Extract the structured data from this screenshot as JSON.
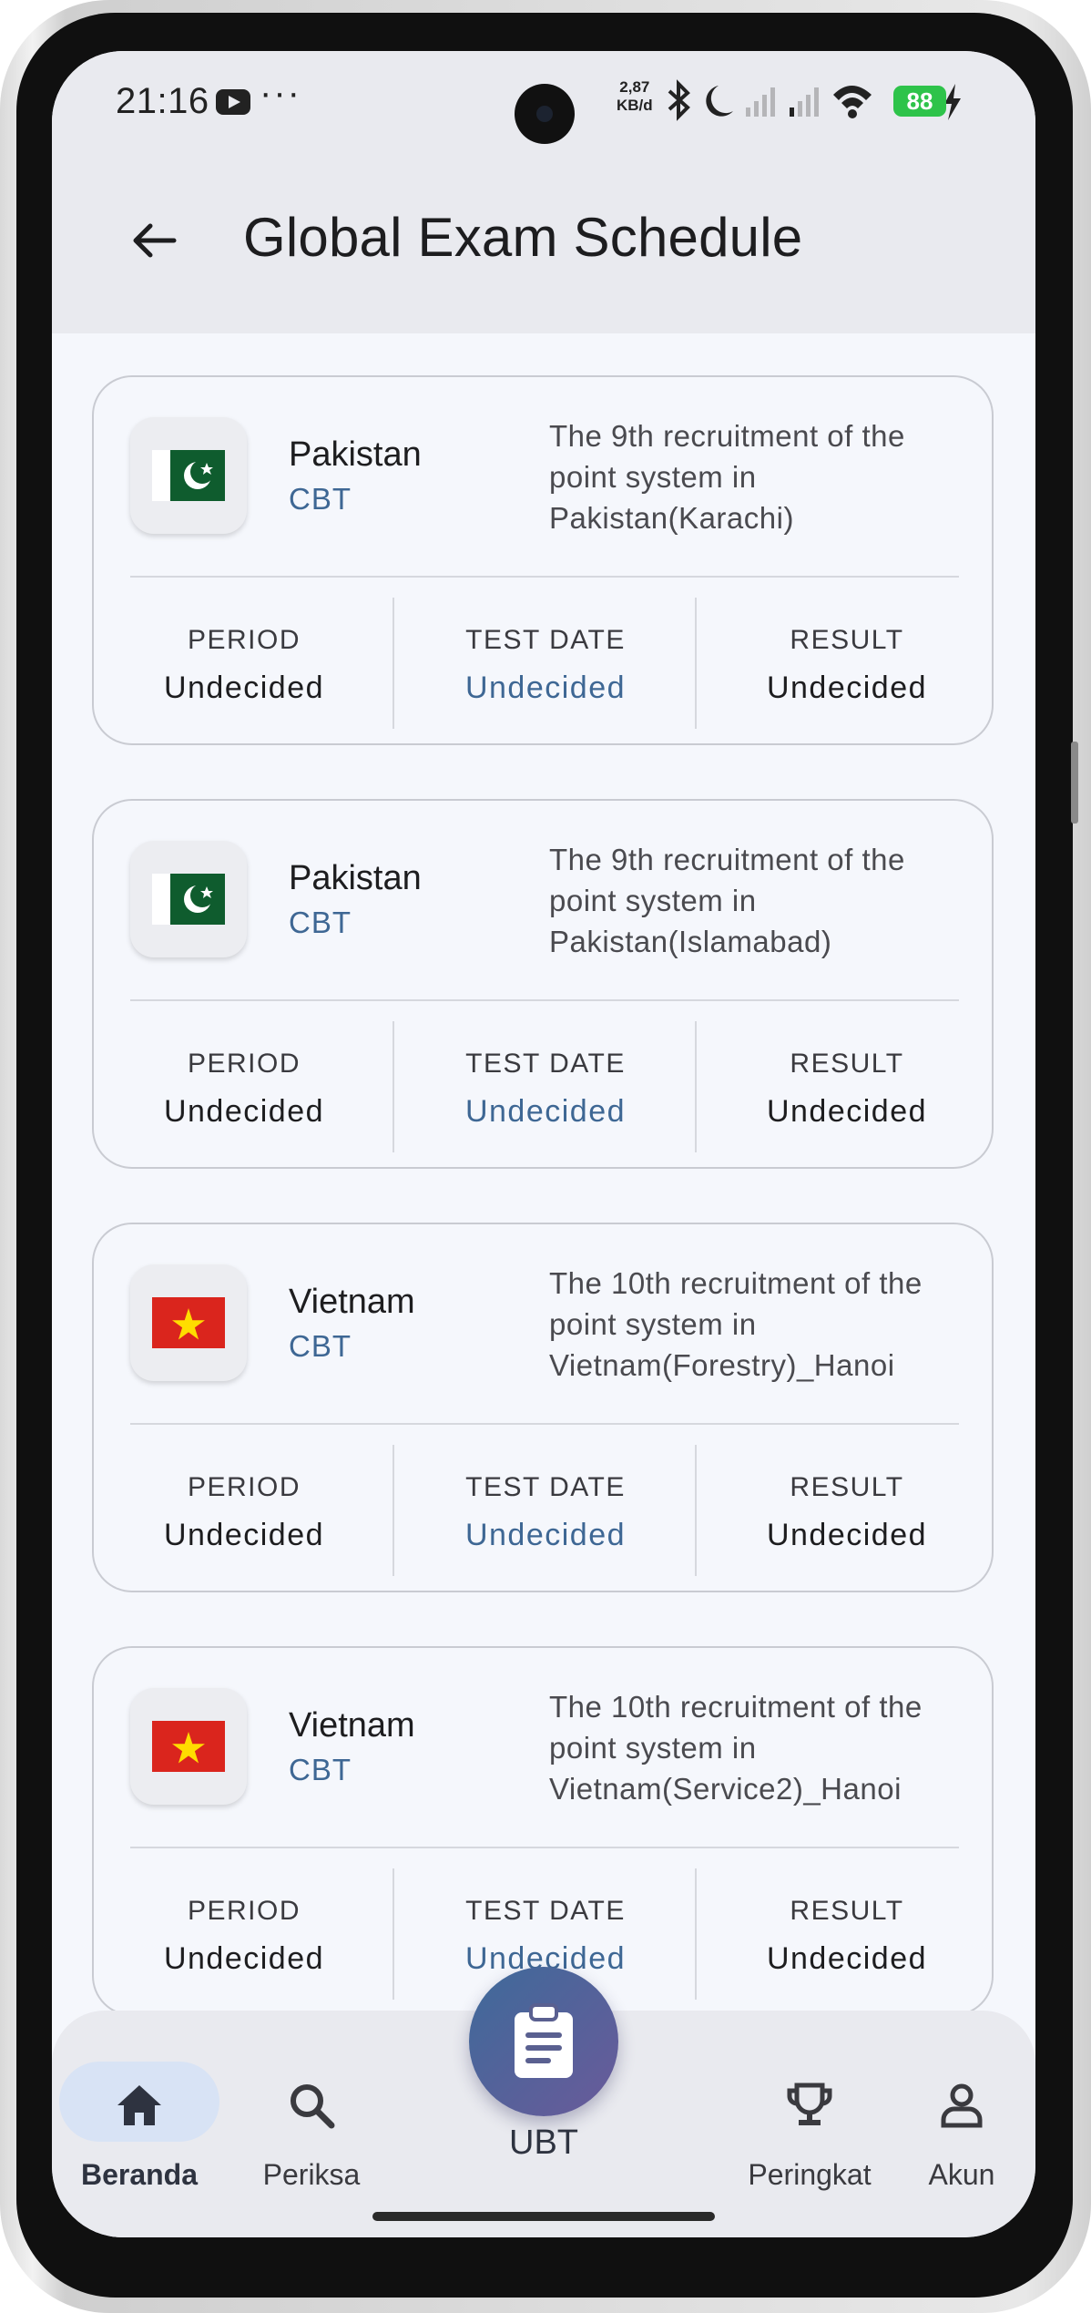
{
  "status": {
    "time": "21:16",
    "more": "···",
    "net_speed_value": "2,87",
    "net_speed_unit": "KB/d",
    "battery": "88"
  },
  "header": {
    "title": "Global Exam Schedule"
  },
  "columns": {
    "period": "PERIOD",
    "test_date": "TEST DATE",
    "result": "RESULT"
  },
  "schedules": [
    {
      "country": "Pakistan",
      "type": "CBT",
      "flag": "pakistan-flag",
      "description": "The 9th recruitment of the point system in Pakistan(Karachi)",
      "period": "Undecided",
      "test_date": "Undecided",
      "result": "Undecided"
    },
    {
      "country": "Pakistan",
      "type": "CBT",
      "flag": "pakistan-flag",
      "description": "The 9th recruitment of the point system in Pakistan(Islamabad)",
      "period": "Undecided",
      "test_date": "Undecided",
      "result": "Undecided"
    },
    {
      "country": "Vietnam",
      "type": "CBT",
      "flag": "vietnam-flag",
      "description": "The 10th recruitment of the point system in Vietnam(Forestry)_Hanoi",
      "period": "Undecided",
      "test_date": "Undecided",
      "result": "Undecided"
    },
    {
      "country": "Vietnam",
      "type": "CBT",
      "flag": "vietnam-flag",
      "description": "The 10th recruitment of the point system in Vietnam(Service2)_Hanoi",
      "period": "Undecided",
      "test_date": "Undecided",
      "result": "Undecided"
    }
  ],
  "nav": {
    "home": "Beranda",
    "search": "Periksa",
    "center": "UBT",
    "ranking": "Peringkat",
    "account": "Akun"
  },
  "colors": {
    "accent": "#3e6794",
    "nav_active_pill": "#d8e3f5",
    "battery": "#2ec34a"
  }
}
